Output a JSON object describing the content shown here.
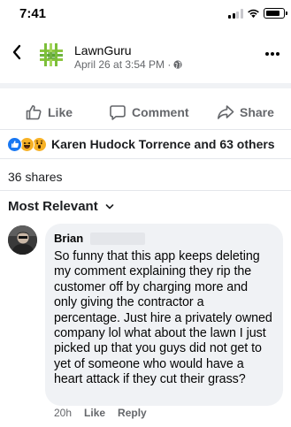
{
  "status_bar": {
    "time": "7:41",
    "battery_level": 0.85
  },
  "post_header": {
    "page_name": "LawnGuru",
    "meta": "April 26 at 3:54 PM · ",
    "icons": {
      "back": "back-icon",
      "privacy": "globe-icon",
      "more": "more-icon"
    }
  },
  "actions": {
    "like": "Like",
    "comment": "Comment",
    "share": "Share"
  },
  "reactions": {
    "types": [
      "like",
      "haha",
      "wow"
    ],
    "summary": "Karen Hudock Torrence and 63 others"
  },
  "shares": "36 shares",
  "sort": {
    "label": "Most Relevant"
  },
  "comment": {
    "author": "Brian",
    "text": "So funny that this app keeps deleting my comment explaining they rip the customer off by charging more and only giving the contractor a percentage. Just hire a privately owned company lol what about the lawn I just picked up that you guys did not get to yet of someone who would have a heart attack if they cut their grass?",
    "time": "20h",
    "like_label": "Like",
    "reply_label": "Reply"
  },
  "colors": {
    "facebook_blue": "#1877f2",
    "secondary_text": "#65676b",
    "bubble_bg": "#f0f2f5",
    "logo_green": "#8dc63f"
  }
}
